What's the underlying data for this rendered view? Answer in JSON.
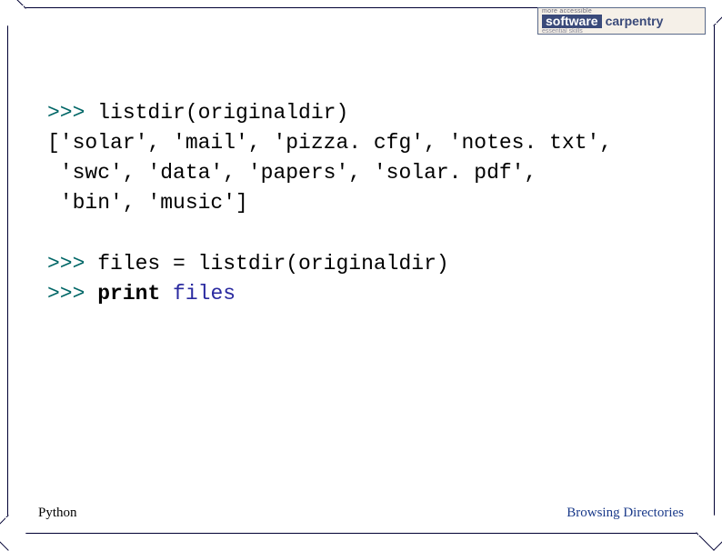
{
  "logo": {
    "tagline_top": "more accessible",
    "word1": "software",
    "word2": "carpentry",
    "tagline_bottom": "essential skills"
  },
  "code": {
    "prompt": ">>>",
    "line1_cmd": " listdir(originaldir)",
    "out1": "['solar', 'mail', 'pizza. cfg', 'notes. txt',",
    "out2": " 'swc', 'data', 'papers', 'solar. pdf',",
    "out3": " 'bin', 'music']",
    "line2_cmd": " files = listdir(originaldir)",
    "line3_kw": "print",
    "line3_var": " files"
  },
  "footer": {
    "left": "Python",
    "right": "Browsing Directories"
  }
}
